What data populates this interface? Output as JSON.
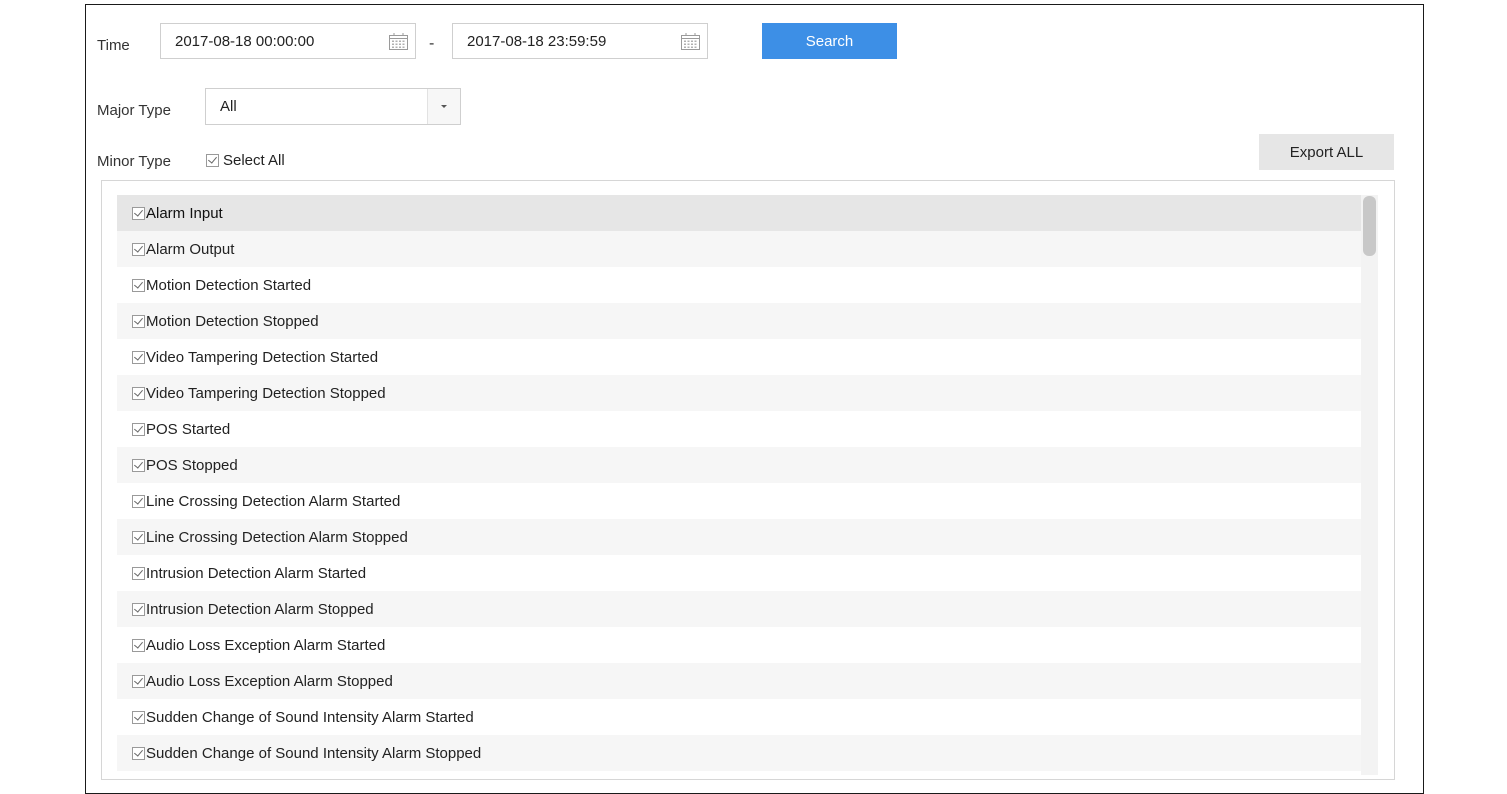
{
  "filters": {
    "time_label": "Time",
    "start_time": "2017-08-18 00:00:00",
    "separator": "-",
    "end_time": "2017-08-18 23:59:59",
    "search_label": "Search",
    "major_type_label": "Major Type",
    "major_type_value": "All",
    "minor_type_label": "Minor Type",
    "select_all_label": "Select All",
    "export_all_label": "Export ALL"
  },
  "minor_types": [
    {
      "label": "Alarm Input",
      "checked": true
    },
    {
      "label": "Alarm Output",
      "checked": true
    },
    {
      "label": "Motion Detection Started",
      "checked": true
    },
    {
      "label": "Motion Detection Stopped",
      "checked": true
    },
    {
      "label": "Video Tampering Detection Started",
      "checked": true
    },
    {
      "label": "Video Tampering Detection Stopped",
      "checked": true
    },
    {
      "label": "POS Started",
      "checked": true
    },
    {
      "label": "POS Stopped",
      "checked": true
    },
    {
      "label": "Line Crossing Detection Alarm Started",
      "checked": true
    },
    {
      "label": "Line Crossing Detection Alarm Stopped",
      "checked": true
    },
    {
      "label": "Intrusion Detection Alarm Started",
      "checked": true
    },
    {
      "label": "Intrusion Detection Alarm Stopped",
      "checked": true
    },
    {
      "label": "Audio Loss Exception Alarm Started",
      "checked": true
    },
    {
      "label": "Audio Loss Exception Alarm Stopped",
      "checked": true
    },
    {
      "label": "Sudden Change of Sound Intensity Alarm Started",
      "checked": true
    },
    {
      "label": "Sudden Change of Sound Intensity Alarm Stopped",
      "checked": true
    }
  ],
  "colors": {
    "accent": "#3d8fe6",
    "selected_row": "#e6e6e6"
  },
  "icons": {
    "calendar": "calendar-icon",
    "dropdown": "chevron-down-icon",
    "checkbox": "checkbox-checked-icon"
  }
}
